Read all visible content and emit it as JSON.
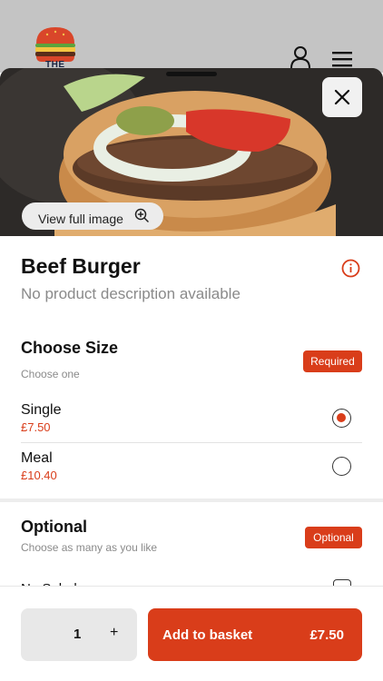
{
  "brand": {
    "logo_text": "THE"
  },
  "header": {
    "icons": [
      "user-icon",
      "menu-icon"
    ]
  },
  "hero": {
    "view_full_label": "View full image"
  },
  "product": {
    "name": "Beef Burger",
    "description": "No product description available"
  },
  "size_section": {
    "title": "Choose Size",
    "subtitle": "Choose one",
    "badge": "Required",
    "options": [
      {
        "name": "Single",
        "price": "£7.50",
        "selected": true
      },
      {
        "name": "Meal",
        "price": "£10.40",
        "selected": false
      }
    ]
  },
  "optional_section": {
    "title": "Optional",
    "subtitle": "Choose as many as you like",
    "badge": "Optional",
    "first_item_partial": "No Salad"
  },
  "footer": {
    "quantity": "1",
    "plus": "+",
    "add_label": "Add to basket",
    "total": "£7.50"
  },
  "colors": {
    "accent": "#d93d1a",
    "header_bg": "#c4c4c4",
    "badge_text": "#ffffff"
  }
}
